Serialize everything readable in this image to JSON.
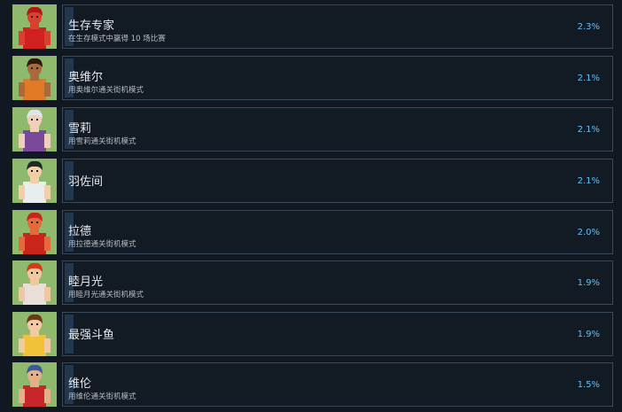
{
  "achievements": [
    {
      "name": "生存专家",
      "desc": "在生存模式中赢得 10 场比赛",
      "pct": "2.3%",
      "icon": "red-fighter-portrait-icon",
      "palette": {
        "skin": "#d9412f",
        "hair": "#b31414",
        "outfit": "#d12020"
      }
    },
    {
      "name": "奥维尔",
      "desc": "用奥维尔通关街机模式",
      "pct": "2.1%",
      "icon": "orville-portrait-icon",
      "palette": {
        "skin": "#a86a3c",
        "hair": "#2c1a10",
        "outfit": "#e07a23"
      }
    },
    {
      "name": "雪莉",
      "desc": "用雪莉通关街机模式",
      "pct": "2.1%",
      "icon": "shirley-portrait-icon",
      "palette": {
        "skin": "#f0d0b8",
        "hair": "#dfe5ef",
        "outfit": "#7a4a9a"
      }
    },
    {
      "name": "羽佐间",
      "desc": "",
      "pct": "2.1%",
      "icon": "hazama-portrait-icon",
      "palette": {
        "skin": "#f2cfa9",
        "hair": "#1c2a24",
        "outfit": "#e8eef0"
      }
    },
    {
      "name": "拉德",
      "desc": "用拉德通关街机模式",
      "pct": "2.0%",
      "icon": "rad-portrait-icon",
      "palette": {
        "skin": "#e46a3c",
        "hair": "#c8261a",
        "outfit": "#c8261a"
      }
    },
    {
      "name": "睦月光",
      "desc": "用睦月光通关街机模式",
      "pct": "1.9%",
      "icon": "mutsuki-portrait-icon",
      "palette": {
        "skin": "#f0c8a0",
        "hair": "#d23a1e",
        "outfit": "#e8e0d8"
      }
    },
    {
      "name": "最强斗鱼",
      "desc": "",
      "pct": "1.9%",
      "icon": "strongest-fish-portrait-icon",
      "palette": {
        "skin": "#f3c9a2",
        "hair": "#6a3a1a",
        "outfit": "#f0c23a"
      }
    },
    {
      "name": "维伦",
      "desc": "用维伦通关街机模式",
      "pct": "1.5%",
      "icon": "viren-portrait-icon",
      "palette": {
        "skin": "#e2b18a",
        "hair": "#3a5a9a",
        "outfit": "#c8262a"
      }
    }
  ]
}
